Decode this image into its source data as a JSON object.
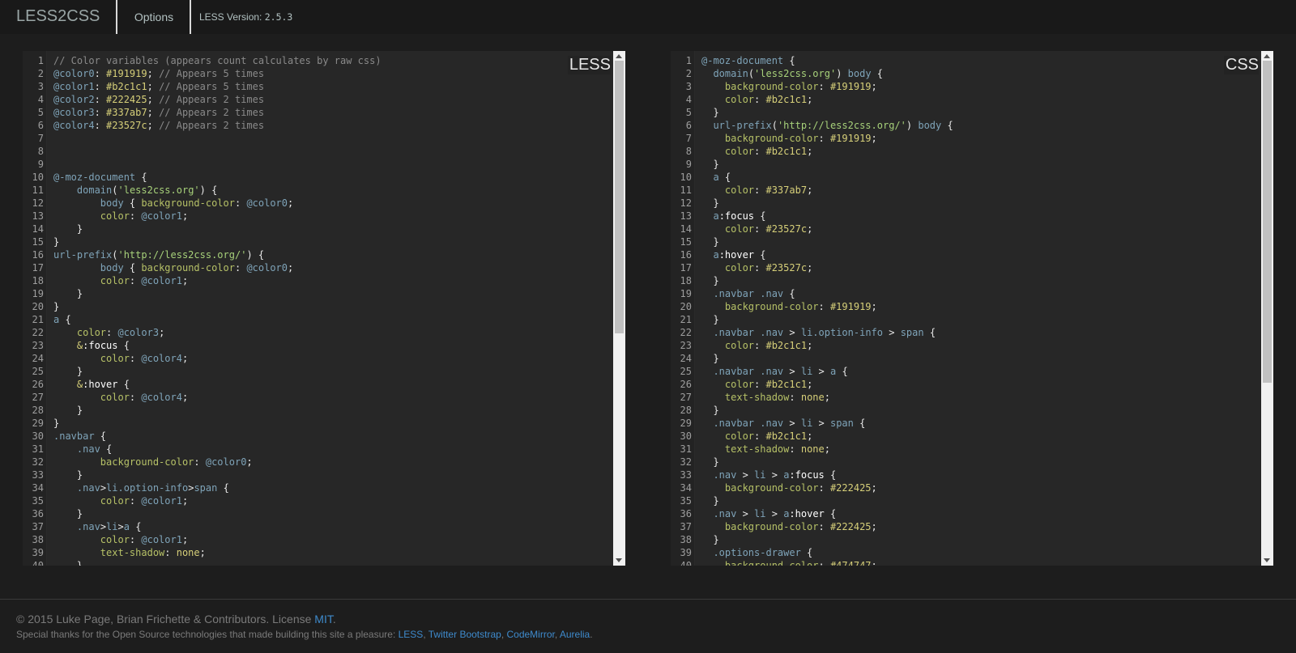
{
  "navbar": {
    "brand": "LESS2CSS",
    "options_label": "Options",
    "version_label": "LESS Version:",
    "version_value": "2.5.3"
  },
  "less_editor": {
    "label": "LESS",
    "scroll_fraction_visible": 0.55,
    "lines": [
      [
        [
          "c",
          "// Color variables (appears count calculates by raw css)"
        ]
      ],
      [
        [
          "v",
          "@color0"
        ],
        [
          "p",
          ": "
        ],
        [
          "n",
          "#191919"
        ],
        [
          "p",
          "; "
        ],
        [
          "c",
          "// Appears 5 times"
        ]
      ],
      [
        [
          "v",
          "@color1"
        ],
        [
          "p",
          ": "
        ],
        [
          "n",
          "#b2c1c1"
        ],
        [
          "p",
          "; "
        ],
        [
          "c",
          "// Appears 5 times"
        ]
      ],
      [
        [
          "v",
          "@color2"
        ],
        [
          "p",
          ": "
        ],
        [
          "n",
          "#222425"
        ],
        [
          "p",
          "; "
        ],
        [
          "c",
          "// Appears 2 times"
        ]
      ],
      [
        [
          "v",
          "@color3"
        ],
        [
          "p",
          ": "
        ],
        [
          "n",
          "#337ab7"
        ],
        [
          "p",
          "; "
        ],
        [
          "c",
          "// Appears 2 times"
        ]
      ],
      [
        [
          "v",
          "@color4"
        ],
        [
          "p",
          ": "
        ],
        [
          "n",
          "#23527c"
        ],
        [
          "p",
          "; "
        ],
        [
          "c",
          "// Appears 2 times"
        ]
      ],
      [],
      [],
      [],
      [
        [
          "v",
          "@-moz-document"
        ],
        [
          "p",
          " {"
        ]
      ],
      [
        [
          "p",
          "    "
        ],
        [
          "t",
          "domain"
        ],
        [
          "p",
          "("
        ],
        [
          "s",
          "'less2css.org'"
        ],
        [
          "p",
          ") {"
        ]
      ],
      [
        [
          "p",
          "        "
        ],
        [
          "t",
          "body"
        ],
        [
          "p",
          " { "
        ],
        [
          "r",
          "background-color"
        ],
        [
          "p",
          ": "
        ],
        [
          "v",
          "@color0"
        ],
        [
          "p",
          ";"
        ]
      ],
      [
        [
          "p",
          "        "
        ],
        [
          "r",
          "color"
        ],
        [
          "p",
          ": "
        ],
        [
          "v",
          "@color1"
        ],
        [
          "p",
          ";"
        ]
      ],
      [
        [
          "p",
          "    }"
        ]
      ],
      [
        [
          "p",
          "}"
        ]
      ],
      [
        [
          "t",
          "url-prefix"
        ],
        [
          "p",
          "("
        ],
        [
          "s",
          "'http://less2css.org/'"
        ],
        [
          "p",
          ") {"
        ]
      ],
      [
        [
          "p",
          "        "
        ],
        [
          "t",
          "body"
        ],
        [
          "p",
          " { "
        ],
        [
          "r",
          "background-color"
        ],
        [
          "p",
          ": "
        ],
        [
          "v",
          "@color0"
        ],
        [
          "p",
          ";"
        ]
      ],
      [
        [
          "p",
          "        "
        ],
        [
          "r",
          "color"
        ],
        [
          "p",
          ": "
        ],
        [
          "v",
          "@color1"
        ],
        [
          "p",
          ";"
        ]
      ],
      [
        [
          "p",
          "    }"
        ]
      ],
      [
        [
          "p",
          "}"
        ]
      ],
      [
        [
          "t",
          "a"
        ],
        [
          "p",
          " {"
        ]
      ],
      [
        [
          "p",
          "    "
        ],
        [
          "r",
          "color"
        ],
        [
          "p",
          ": "
        ],
        [
          "v",
          "@color3"
        ],
        [
          "p",
          ";"
        ]
      ],
      [
        [
          "p",
          "    "
        ],
        [
          "n",
          "&"
        ],
        [
          "k",
          ":focus"
        ],
        [
          "p",
          " {"
        ]
      ],
      [
        [
          "p",
          "        "
        ],
        [
          "r",
          "color"
        ],
        [
          "p",
          ": "
        ],
        [
          "v",
          "@color4"
        ],
        [
          "p",
          ";"
        ]
      ],
      [
        [
          "p",
          "    }"
        ]
      ],
      [
        [
          "p",
          "    "
        ],
        [
          "n",
          "&"
        ],
        [
          "k",
          ":hover"
        ],
        [
          "p",
          " {"
        ]
      ],
      [
        [
          "p",
          "        "
        ],
        [
          "r",
          "color"
        ],
        [
          "p",
          ": "
        ],
        [
          "v",
          "@color4"
        ],
        [
          "p",
          ";"
        ]
      ],
      [
        [
          "p",
          "    }"
        ]
      ],
      [
        [
          "p",
          "}"
        ]
      ],
      [
        [
          "t",
          ".navbar"
        ],
        [
          "p",
          " {"
        ]
      ],
      [
        [
          "p",
          "    "
        ],
        [
          "t",
          ".nav"
        ],
        [
          "p",
          " {"
        ]
      ],
      [
        [
          "p",
          "        "
        ],
        [
          "r",
          "background-color"
        ],
        [
          "p",
          ": "
        ],
        [
          "v",
          "@color0"
        ],
        [
          "p",
          ";"
        ]
      ],
      [
        [
          "p",
          "    }"
        ]
      ],
      [
        [
          "p",
          "    "
        ],
        [
          "t",
          ".nav"
        ],
        [
          "p",
          ">"
        ],
        [
          "t",
          "li.option-info"
        ],
        [
          "p",
          ">"
        ],
        [
          "t",
          "span"
        ],
        [
          "p",
          " {"
        ]
      ],
      [
        [
          "p",
          "        "
        ],
        [
          "r",
          "color"
        ],
        [
          "p",
          ": "
        ],
        [
          "v",
          "@color1"
        ],
        [
          "p",
          ";"
        ]
      ],
      [
        [
          "p",
          "    }"
        ]
      ],
      [
        [
          "p",
          "    "
        ],
        [
          "t",
          ".nav"
        ],
        [
          "p",
          ">"
        ],
        [
          "t",
          "li"
        ],
        [
          "p",
          ">"
        ],
        [
          "t",
          "a"
        ],
        [
          "p",
          " {"
        ]
      ],
      [
        [
          "p",
          "        "
        ],
        [
          "r",
          "color"
        ],
        [
          "p",
          ": "
        ],
        [
          "v",
          "@color1"
        ],
        [
          "p",
          ";"
        ]
      ],
      [
        [
          "p",
          "        "
        ],
        [
          "r",
          "text-shadow"
        ],
        [
          "p",
          ": "
        ],
        [
          "n",
          "none"
        ],
        [
          "p",
          ";"
        ]
      ],
      [
        [
          "p",
          "    }"
        ]
      ]
    ]
  },
  "css_editor": {
    "label": "CSS",
    "scroll_fraction_visible": 0.65,
    "lines": [
      [
        [
          "v",
          "@-moz-document"
        ],
        [
          "p",
          " {"
        ]
      ],
      [
        [
          "p",
          "  "
        ],
        [
          "t",
          "domain"
        ],
        [
          "p",
          "("
        ],
        [
          "s",
          "'less2css.org'"
        ],
        [
          "p",
          ") "
        ],
        [
          "t",
          "body"
        ],
        [
          "p",
          " {"
        ]
      ],
      [
        [
          "p",
          "    "
        ],
        [
          "r",
          "background-color"
        ],
        [
          "p",
          ": "
        ],
        [
          "n",
          "#191919"
        ],
        [
          "p",
          ";"
        ]
      ],
      [
        [
          "p",
          "    "
        ],
        [
          "r",
          "color"
        ],
        [
          "p",
          ": "
        ],
        [
          "n",
          "#b2c1c1"
        ],
        [
          "p",
          ";"
        ]
      ],
      [
        [
          "p",
          "  }"
        ]
      ],
      [
        [
          "p",
          "  "
        ],
        [
          "t",
          "url-prefix"
        ],
        [
          "p",
          "("
        ],
        [
          "s",
          "'http://less2css.org/'"
        ],
        [
          "p",
          ") "
        ],
        [
          "t",
          "body"
        ],
        [
          "p",
          " {"
        ]
      ],
      [
        [
          "p",
          "    "
        ],
        [
          "r",
          "background-color"
        ],
        [
          "p",
          ": "
        ],
        [
          "n",
          "#191919"
        ],
        [
          "p",
          ";"
        ]
      ],
      [
        [
          "p",
          "    "
        ],
        [
          "r",
          "color"
        ],
        [
          "p",
          ": "
        ],
        [
          "n",
          "#b2c1c1"
        ],
        [
          "p",
          ";"
        ]
      ],
      [
        [
          "p",
          "  }"
        ]
      ],
      [
        [
          "p",
          "  "
        ],
        [
          "t",
          "a"
        ],
        [
          "p",
          " {"
        ]
      ],
      [
        [
          "p",
          "    "
        ],
        [
          "r",
          "color"
        ],
        [
          "p",
          ": "
        ],
        [
          "n",
          "#337ab7"
        ],
        [
          "p",
          ";"
        ]
      ],
      [
        [
          "p",
          "  }"
        ]
      ],
      [
        [
          "p",
          "  "
        ],
        [
          "t",
          "a"
        ],
        [
          "k",
          ":focus"
        ],
        [
          "p",
          " {"
        ]
      ],
      [
        [
          "p",
          "    "
        ],
        [
          "r",
          "color"
        ],
        [
          "p",
          ": "
        ],
        [
          "n",
          "#23527c"
        ],
        [
          "p",
          ";"
        ]
      ],
      [
        [
          "p",
          "  }"
        ]
      ],
      [
        [
          "p",
          "  "
        ],
        [
          "t",
          "a"
        ],
        [
          "k",
          ":hover"
        ],
        [
          "p",
          " {"
        ]
      ],
      [
        [
          "p",
          "    "
        ],
        [
          "r",
          "color"
        ],
        [
          "p",
          ": "
        ],
        [
          "n",
          "#23527c"
        ],
        [
          "p",
          ";"
        ]
      ],
      [
        [
          "p",
          "  }"
        ]
      ],
      [
        [
          "p",
          "  "
        ],
        [
          "t",
          ".navbar .nav"
        ],
        [
          "p",
          " {"
        ]
      ],
      [
        [
          "p",
          "    "
        ],
        [
          "r",
          "background-color"
        ],
        [
          "p",
          ": "
        ],
        [
          "n",
          "#191919"
        ],
        [
          "p",
          ";"
        ]
      ],
      [
        [
          "p",
          "  }"
        ]
      ],
      [
        [
          "p",
          "  "
        ],
        [
          "t",
          ".navbar .nav"
        ],
        [
          "p",
          " > "
        ],
        [
          "t",
          "li.option-info"
        ],
        [
          "p",
          " > "
        ],
        [
          "t",
          "span"
        ],
        [
          "p",
          " {"
        ]
      ],
      [
        [
          "p",
          "    "
        ],
        [
          "r",
          "color"
        ],
        [
          "p",
          ": "
        ],
        [
          "n",
          "#b2c1c1"
        ],
        [
          "p",
          ";"
        ]
      ],
      [
        [
          "p",
          "  }"
        ]
      ],
      [
        [
          "p",
          "  "
        ],
        [
          "t",
          ".navbar .nav"
        ],
        [
          "p",
          " > "
        ],
        [
          "t",
          "li"
        ],
        [
          "p",
          " > "
        ],
        [
          "t",
          "a"
        ],
        [
          "p",
          " {"
        ]
      ],
      [
        [
          "p",
          "    "
        ],
        [
          "r",
          "color"
        ],
        [
          "p",
          ": "
        ],
        [
          "n",
          "#b2c1c1"
        ],
        [
          "p",
          ";"
        ]
      ],
      [
        [
          "p",
          "    "
        ],
        [
          "r",
          "text-shadow"
        ],
        [
          "p",
          ": "
        ],
        [
          "n",
          "none"
        ],
        [
          "p",
          ";"
        ]
      ],
      [
        [
          "p",
          "  }"
        ]
      ],
      [
        [
          "p",
          "  "
        ],
        [
          "t",
          ".navbar .nav"
        ],
        [
          "p",
          " > "
        ],
        [
          "t",
          "li"
        ],
        [
          "p",
          " > "
        ],
        [
          "t",
          "span"
        ],
        [
          "p",
          " {"
        ]
      ],
      [
        [
          "p",
          "    "
        ],
        [
          "r",
          "color"
        ],
        [
          "p",
          ": "
        ],
        [
          "n",
          "#b2c1c1"
        ],
        [
          "p",
          ";"
        ]
      ],
      [
        [
          "p",
          "    "
        ],
        [
          "r",
          "text-shadow"
        ],
        [
          "p",
          ": "
        ],
        [
          "n",
          "none"
        ],
        [
          "p",
          ";"
        ]
      ],
      [
        [
          "p",
          "  }"
        ]
      ],
      [
        [
          "p",
          "  "
        ],
        [
          "t",
          ".nav"
        ],
        [
          "p",
          " > "
        ],
        [
          "t",
          "li"
        ],
        [
          "p",
          " > "
        ],
        [
          "t",
          "a"
        ],
        [
          "k",
          ":focus"
        ],
        [
          "p",
          " {"
        ]
      ],
      [
        [
          "p",
          "    "
        ],
        [
          "r",
          "background-color"
        ],
        [
          "p",
          ": "
        ],
        [
          "n",
          "#222425"
        ],
        [
          "p",
          ";"
        ]
      ],
      [
        [
          "p",
          "  }"
        ]
      ],
      [
        [
          "p",
          "  "
        ],
        [
          "t",
          ".nav"
        ],
        [
          "p",
          " > "
        ],
        [
          "t",
          "li"
        ],
        [
          "p",
          " > "
        ],
        [
          "t",
          "a"
        ],
        [
          "k",
          ":hover"
        ],
        [
          "p",
          " {"
        ]
      ],
      [
        [
          "p",
          "    "
        ],
        [
          "r",
          "background-color"
        ],
        [
          "p",
          ": "
        ],
        [
          "n",
          "#222425"
        ],
        [
          "p",
          ";"
        ]
      ],
      [
        [
          "p",
          "  }"
        ]
      ],
      [
        [
          "p",
          "  "
        ],
        [
          "t",
          ".options-drawer"
        ],
        [
          "p",
          " {"
        ]
      ],
      [
        [
          "p",
          "    "
        ],
        [
          "r",
          "background-color"
        ],
        [
          "p",
          ": "
        ],
        [
          "n",
          "#474747"
        ],
        [
          "p",
          ";"
        ]
      ]
    ]
  },
  "footer": {
    "copyright": "© 2015 Luke Page, Brian Frichette & Contributors. License ",
    "license_link": "MIT",
    "copyright_end": ".",
    "thanks": "Special thanks for the Open Source technologies that made building this site a pleasure: ",
    "links": [
      "LESS",
      "Twitter Bootstrap",
      "CodeMirror",
      "Aurelia"
    ],
    "sep": ", ",
    "thanks_end": "."
  },
  "colors": {
    "background": "#1d1d1d",
    "navbar": "#191919",
    "editor_bg": "#272727",
    "link": "#3e8acc"
  }
}
